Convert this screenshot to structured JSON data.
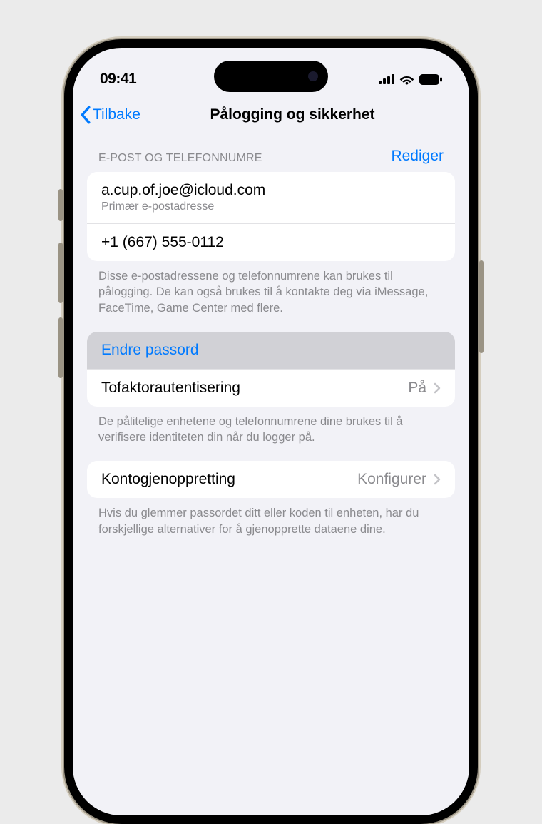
{
  "statusBar": {
    "time": "09:41"
  },
  "nav": {
    "back": "Tilbake",
    "title": "Pålogging og sikkerhet"
  },
  "contactSection": {
    "header": "E-POST OG TELEFONNUMRE",
    "editLabel": "Rediger",
    "email": "a.cup.of.joe@icloud.com",
    "emailSubtitle": "Primær e-postadresse",
    "phone": "+1 (667) 555-0112",
    "footer": "Disse e-postadressene og telefonnumrene kan brukes til pålogging. De kan også brukes til å kontakte deg via iMessage, FaceTime, Game Center med flere."
  },
  "securitySection": {
    "changePassword": "Endre passord",
    "twoFactorLabel": "Tofaktorautentisering",
    "twoFactorValue": "På",
    "footer": "De pålitelige enhetene og telefonnumrene dine brukes til å verifisere identiteten din når du logger på."
  },
  "recoverySection": {
    "label": "Kontogjenoppretting",
    "value": "Konfigurer",
    "footer": "Hvis du glemmer passordet ditt eller koden til enheten, har du forskjellige alternativer for å gjenopprette dataene dine."
  }
}
